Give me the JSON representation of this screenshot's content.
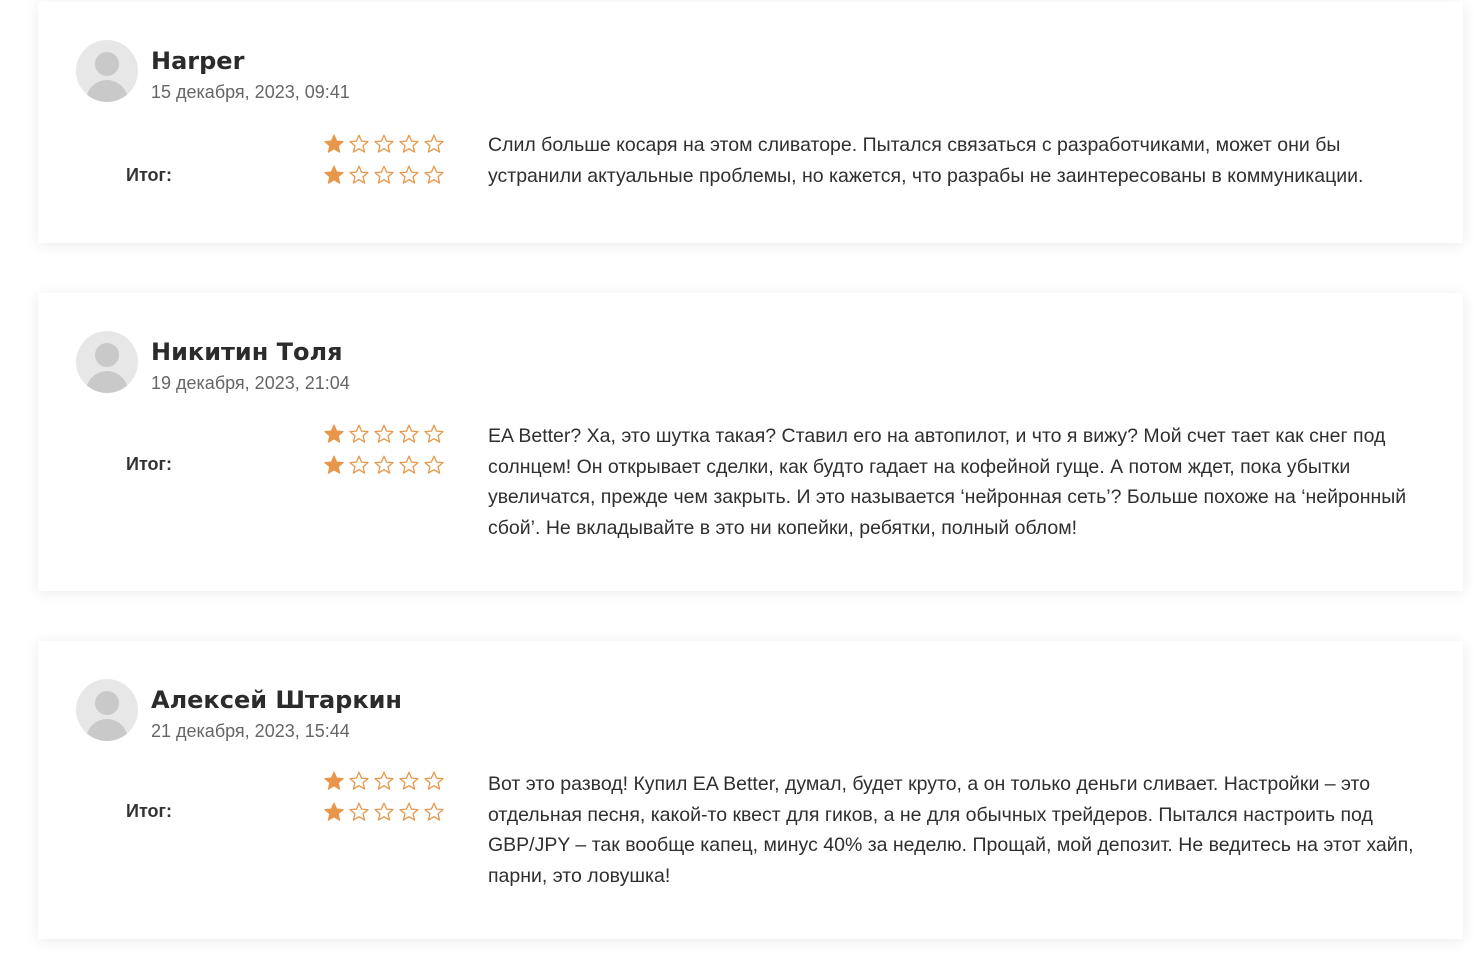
{
  "accent_color": "#e8964a",
  "reviews": [
    {
      "author": "Harper",
      "date": "15 декабря, 2023, 09:41",
      "rating_label": "Итог:",
      "rating_rows": [
        1,
        1
      ],
      "max_stars": 5,
      "text": "Слил больше косаря на этом сливаторе. Пытался связаться с разработчиками, может они бы устранили актуальные проблемы, но кажется, что разрабы не заинтересованы в коммуникации."
    },
    {
      "author": "Никитин Толя",
      "date": "19 декабря, 2023, 21:04",
      "rating_label": "Итог:",
      "rating_rows": [
        1,
        1
      ],
      "max_stars": 5,
      "text": "EA Better? Ха, это шутка такая? Ставил его на автопилот, и что я вижу? Мой счет тает как снег под солнцем! Он открывает сделки, как будто гадает на кофейной гуще. А потом ждет, пока убытки увеличатся, прежде чем закрыть. И это называется ‘нейронная сеть’? Больше похоже на ‘нейронный сбой’. Не вкладывайте в это ни копейки, ребятки, полный облом!"
    },
    {
      "author": "Алексей Штаркин",
      "date": "21 декабря, 2023, 15:44",
      "rating_label": "Итог:",
      "rating_rows": [
        1,
        1
      ],
      "max_stars": 5,
      "text": "Вот это развод! Купил EA Better, думал, будет круто, а он только деньги сливает. Настройки – это отдельная песня, какой-то квест для гиков, а не для обычных трейдеров. Пытался настроить под GBP/JPY – так вообще капец, минус 40% за неделю. Прощай, мой депозит. Не ведитесь на этот хайп, парни, это ловушка!"
    }
  ]
}
